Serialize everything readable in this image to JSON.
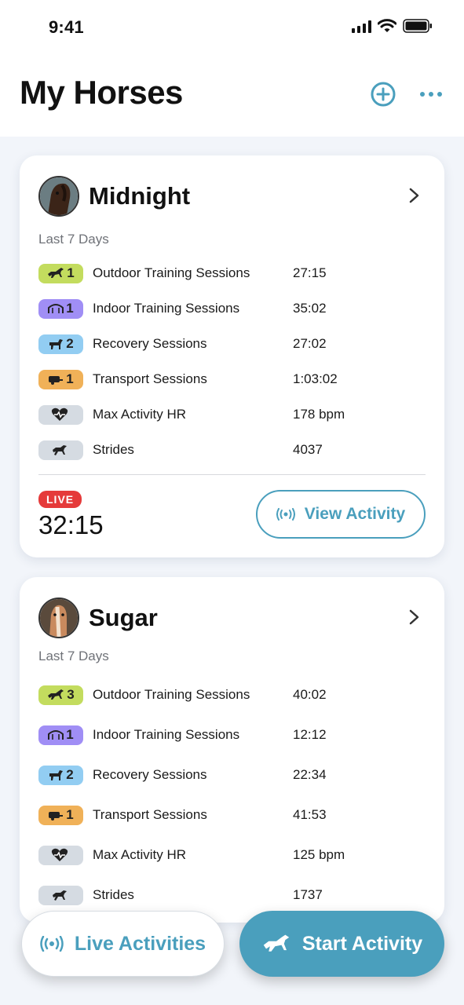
{
  "status_bar": {
    "time": "9:41"
  },
  "header": {
    "title": "My Horses",
    "add_icon": "plus-circle-icon",
    "more_icon": "ellipsis-icon"
  },
  "colors": {
    "accent": "#4a9fbd",
    "outdoor": "#c3dc5e",
    "indoor": "#a08ef5",
    "recovery": "#92cdf2",
    "transport": "#f0b158",
    "neutral": "#d5dbe2",
    "live": "#e53a3a"
  },
  "horses": [
    {
      "name": "Midnight",
      "period": "Last 7 Days",
      "stats": [
        {
          "icon": "galloping-horse-icon",
          "count": "1",
          "label": "Outdoor Training Sessions",
          "value": "27:15"
        },
        {
          "icon": "barn-icon",
          "count": "1",
          "label": "Indoor Training Sessions",
          "value": "35:02"
        },
        {
          "icon": "standing-horse-icon",
          "count": "2",
          "label": "Recovery Sessions",
          "value": "27:02"
        },
        {
          "icon": "trailer-icon",
          "count": "1",
          "label": "Transport Sessions",
          "value": "1:03:02"
        },
        {
          "icon": "heart-rate-icon",
          "count": "",
          "label": "Max Activity HR",
          "value": "178 bpm"
        },
        {
          "icon": "trotting-horse-icon",
          "count": "",
          "label": "Strides",
          "value": "4037"
        }
      ],
      "live_badge": "LIVE",
      "live_time": "32:15",
      "view_button": "View Activity"
    },
    {
      "name": "Sugar",
      "period": "Last 7 Days",
      "stats": [
        {
          "icon": "galloping-horse-icon",
          "count": "3",
          "label": "Outdoor Training Sessions",
          "value": "40:02"
        },
        {
          "icon": "barn-icon",
          "count": "1",
          "label": "Indoor Training Sessions",
          "value": "12:12"
        },
        {
          "icon": "standing-horse-icon",
          "count": "2",
          "label": "Recovery Sessions",
          "value": "22:34"
        },
        {
          "icon": "trailer-icon",
          "count": "1",
          "label": "Transport Sessions",
          "value": "41:53"
        },
        {
          "icon": "heart-rate-icon",
          "count": "",
          "label": "Max Activity HR",
          "value": "125 bpm"
        },
        {
          "icon": "trotting-horse-icon",
          "count": "",
          "label": "Strides",
          "value": "1737"
        }
      ]
    }
  ],
  "bottom_bar": {
    "live_activities": "Live Activities",
    "start_activity": "Start Activity"
  }
}
